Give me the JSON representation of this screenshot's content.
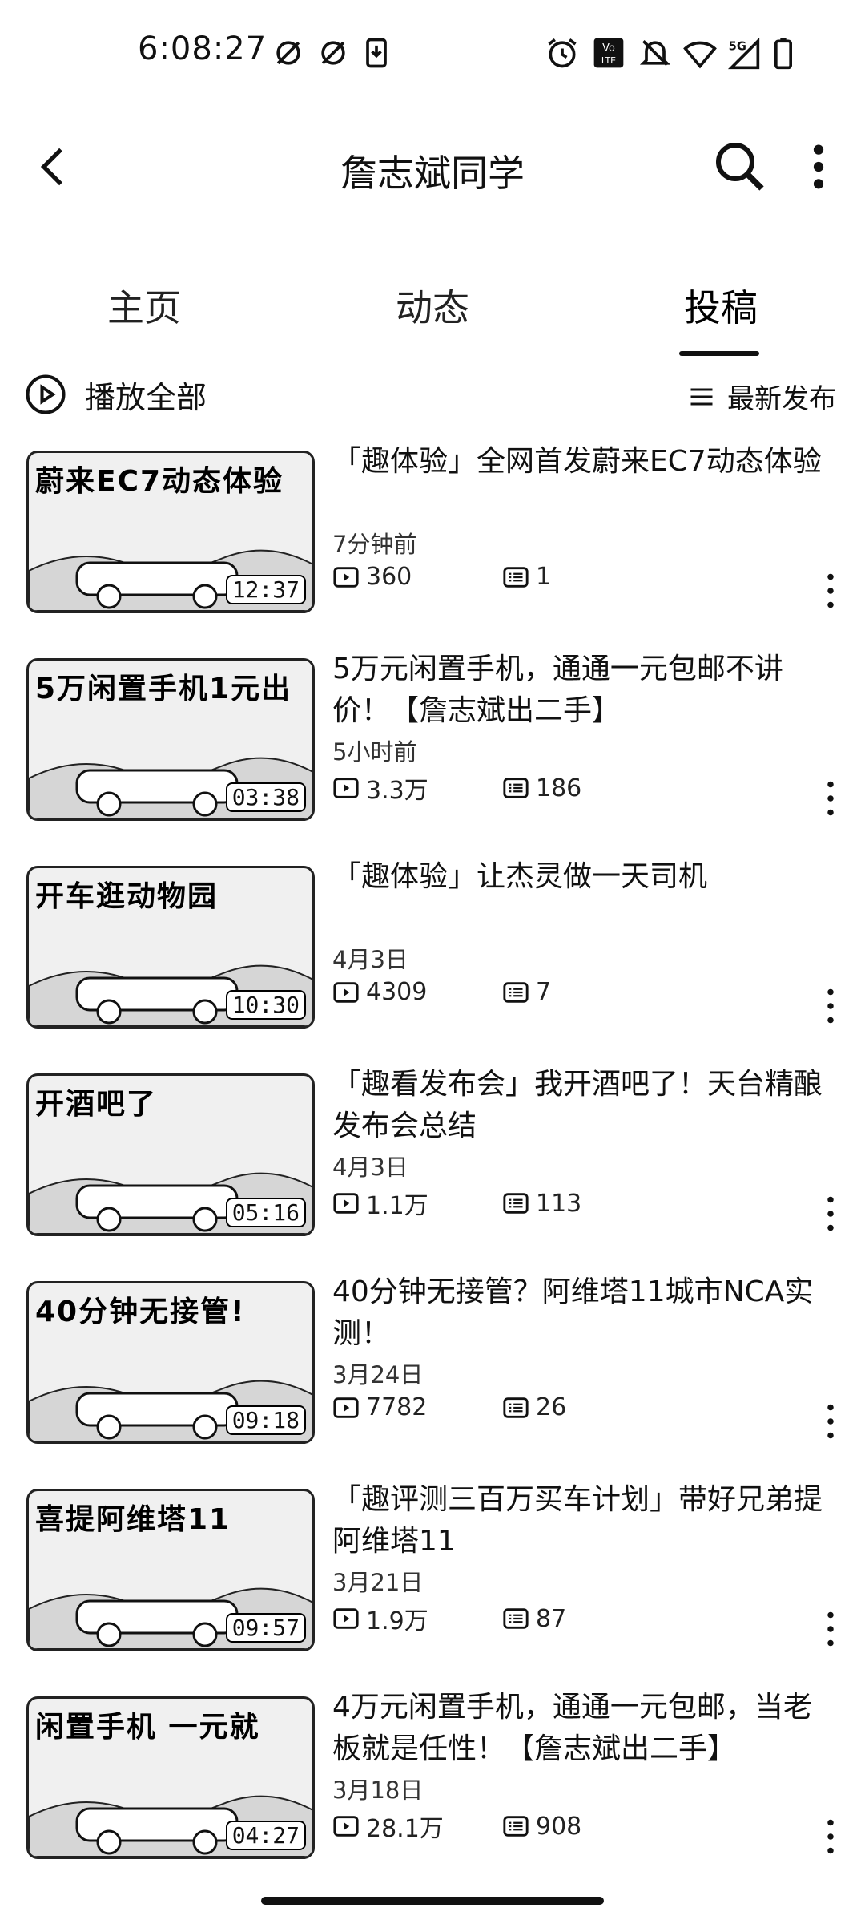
{
  "status_bar": {
    "time": "6:08:27",
    "icons": [
      "sync-off-icon",
      "sync-off-icon",
      "download-icon",
      "alarm-icon",
      "volte-icon",
      "bell-muted-icon",
      "wifi-icon",
      "signal-5g-icon",
      "battery-icon"
    ]
  },
  "app_bar": {
    "title": "詹志斌同学",
    "icons": [
      "back-icon",
      "search-icon",
      "more-vert-icon"
    ]
  },
  "tabs": [
    {
      "label": "主页",
      "active": false
    },
    {
      "label": "动态",
      "active": false
    },
    {
      "label": "投稿",
      "active": true
    }
  ],
  "toolbar": {
    "play_all_label": "播放全部",
    "sort_label": "最新发布"
  },
  "videos": [
    {
      "thumb_caption": "蔚来EC7动态体验",
      "duration": "12:37",
      "title": "「趣体验」全网首发蔚来EC7动态体验",
      "date": "7分钟前",
      "views": "360",
      "comments": "1"
    },
    {
      "thumb_caption": "5万闲置手机1元出",
      "duration": "03:38",
      "title": "5万元闲置手机，通通一元包邮不讲价！【詹志斌出二手】",
      "date": "5小时前",
      "views": "3.3万",
      "comments": "186"
    },
    {
      "thumb_caption": "开车逛动物园",
      "duration": "10:30",
      "title": "「趣体验」让杰灵做一天司机",
      "date": "4月3日",
      "views": "4309",
      "comments": "7"
    },
    {
      "thumb_caption": "开酒吧了",
      "duration": "05:16",
      "title": "「趣看发布会」我开酒吧了！天台精酿发布会总结",
      "date": "4月3日",
      "views": "1.1万",
      "comments": "113"
    },
    {
      "thumb_caption": "40分钟无接管!",
      "duration": "09:18",
      "title": "40分钟无接管？阿维塔11城市NCA实测！",
      "date": "3月24日",
      "views": "7782",
      "comments": "26"
    },
    {
      "thumb_caption": "喜提阿维塔11",
      "duration": "09:57",
      "title": "「趣评测三百万买车计划」带好兄弟提阿维塔11",
      "date": "3月21日",
      "views": "1.9万",
      "comments": "87"
    },
    {
      "thumb_caption": "闲置手机 一元就",
      "duration": "04:27",
      "title": "4万元闲置手机，通通一元包邮，当老板就是任性！【詹志斌出二手】",
      "date": "3月18日",
      "views": "28.1万",
      "comments": "908"
    }
  ]
}
